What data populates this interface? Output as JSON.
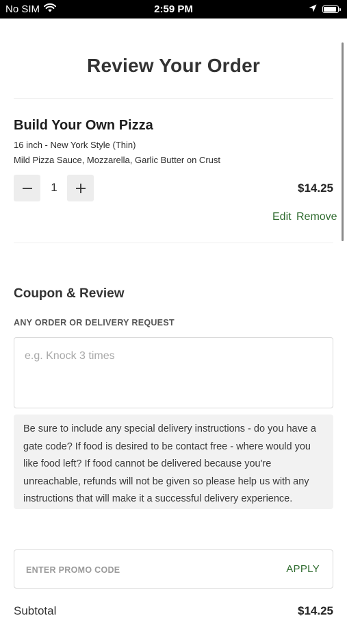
{
  "status_bar": {
    "carrier": "No SIM",
    "time": "2:59 PM",
    "battery_level": 0.9
  },
  "page": {
    "title": "Review Your Order"
  },
  "order_item": {
    "name": "Build Your Own Pizza",
    "size_style": "16 inch - New York Style (Thin)",
    "toppings": "Mild Pizza Sauce, Mozzarella, Garlic Butter on Crust",
    "quantity": "1",
    "price": "$14.25",
    "edit_label": "Edit",
    "remove_label": "Remove"
  },
  "coupon_review": {
    "section_title": "Coupon & Review",
    "request_label": "ANY ORDER OR DELIVERY REQUEST",
    "request_placeholder": "e.g. Knock 3 times",
    "request_value": "",
    "notice": "Be sure to include any special delivery instructions - do you have a gate code? If food is desired to be contact free - where would you like food left? If food cannot be delivered because you're unreachable, refunds will not be given so please help us with any instructions that will make it a successful delivery experience.",
    "promo_placeholder": "ENTER PROMO CODE",
    "apply_label": "APPLY"
  },
  "totals": {
    "subtotal_label": "Subtotal",
    "subtotal_value": "$14.25"
  },
  "colors": {
    "accent_green": "#2e6b2e",
    "button_bg": "#ededed",
    "notice_bg": "#f2f2f2"
  },
  "icons": [
    "wifi-icon",
    "location-arrow-icon",
    "battery-icon",
    "minus-icon",
    "plus-icon"
  ]
}
